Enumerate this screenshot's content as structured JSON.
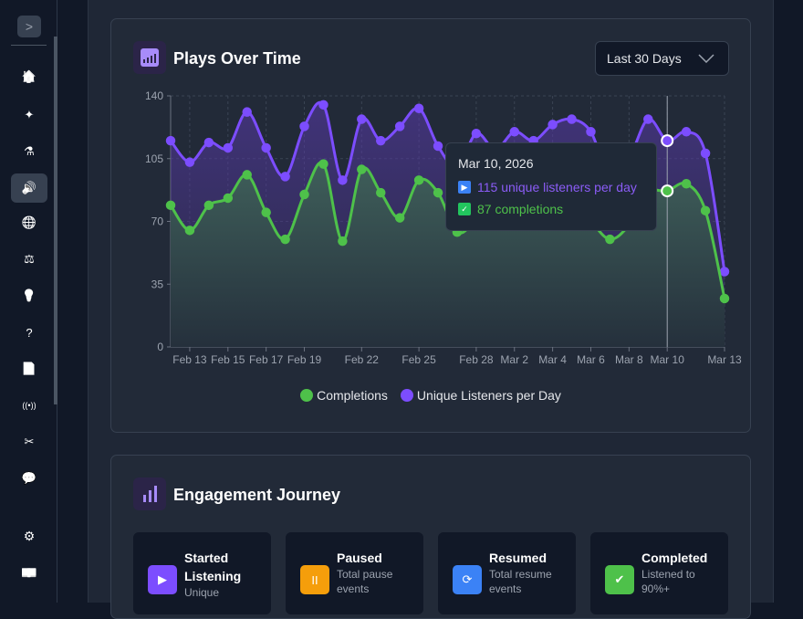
{
  "sidebar": {
    "toggle_icon": "chevron-right-icon",
    "items": [
      {
        "icon": "home-icon",
        "glyph": "🏠"
      },
      {
        "icon": "sparkles-icon",
        "glyph": "✦"
      },
      {
        "icon": "flask-icon",
        "glyph": "⚗"
      },
      {
        "icon": "speaker-icon",
        "glyph": "🔊",
        "active": true
      },
      {
        "icon": "globe-icon",
        "glyph": "🌐"
      },
      {
        "icon": "scale-icon",
        "glyph": "⚖"
      },
      {
        "icon": "lightbulb-icon",
        "glyph": "💡"
      },
      {
        "icon": "help-icon",
        "glyph": "?"
      },
      {
        "icon": "document-icon",
        "glyph": "📄"
      },
      {
        "icon": "broadcast-icon",
        "glyph": "((•))"
      },
      {
        "icon": "tools-icon",
        "glyph": "✂"
      },
      {
        "icon": "chat-icon",
        "glyph": "💬"
      }
    ],
    "bottom": [
      {
        "icon": "gear-icon",
        "glyph": "⚙"
      },
      {
        "icon": "money-icon",
        "glyph": "💵"
      }
    ]
  },
  "plays_card": {
    "title": "Plays Over Time",
    "range_select": "Last 30 Days"
  },
  "tooltip": {
    "date": "Mar 10, 2026",
    "listeners": "115 unique listeners per day",
    "completions": "87 completions"
  },
  "chart_data": {
    "type": "area",
    "x": [
      "Feb 12",
      "Feb 13",
      "Feb 14",
      "Feb 15",
      "Feb 16",
      "Feb 17",
      "Feb 18",
      "Feb 19",
      "Feb 20",
      "Feb 21",
      "Feb 22",
      "Feb 23",
      "Feb 24",
      "Feb 25",
      "Feb 26",
      "Feb 27",
      "Feb 28",
      "Mar 1",
      "Mar 2",
      "Mar 3",
      "Mar 4",
      "Mar 5",
      "Mar 6",
      "Mar 7",
      "Mar 8",
      "Mar 9",
      "Mar 10",
      "Mar 11",
      "Mar 12",
      "Mar 13"
    ],
    "x_ticks": [
      "Feb 13",
      "Feb 15",
      "Feb 17",
      "Feb 19",
      "Feb 22",
      "Feb 25",
      "Feb 28",
      "Mar 2",
      "Mar 4",
      "Mar 6",
      "Mar 8",
      "Mar 10",
      "Mar 13"
    ],
    "y_ticks": [
      0,
      35,
      70,
      105,
      140
    ],
    "ylim": [
      0,
      140
    ],
    "grid": true,
    "legend_position": "bottom",
    "series": [
      {
        "name": "Completions",
        "color": "#4ec14a",
        "values": [
          79,
          65,
          79,
          83,
          96,
          75,
          60,
          85,
          102,
          59,
          99,
          86,
          72,
          93,
          86,
          64,
          70,
          72,
          75,
          72,
          78,
          80,
          70,
          60,
          68,
          86,
          87,
          91,
          76,
          27
        ]
      },
      {
        "name": "Unique Listeners per Day",
        "color": "#7c4dff",
        "values": [
          115,
          103,
          114,
          111,
          131,
          111,
          95,
          123,
          135,
          93,
          127,
          115,
          123,
          133,
          112,
          100,
          119,
          110,
          120,
          115,
          124,
          127,
          120,
          95,
          105,
          127,
          115,
          120,
          108,
          42
        ]
      }
    ]
  },
  "engagement": {
    "title": "Engagement Journey",
    "cards": [
      {
        "title": "Started Listening",
        "sub": "Unique",
        "icon": "play-icon",
        "glyph": "▶",
        "color": "#7c4dff"
      },
      {
        "title": "Paused",
        "sub": "Total pause events",
        "icon": "pause-icon",
        "glyph": "II",
        "color": "#f59e0b"
      },
      {
        "title": "Resumed",
        "sub": "Total resume events",
        "icon": "refresh-icon",
        "glyph": "⟳",
        "color": "#3b82f6"
      },
      {
        "title": "Completed",
        "sub": "Listened to 90%+",
        "icon": "check-circle-icon",
        "glyph": "✔",
        "color": "#4ec14a"
      }
    ]
  }
}
